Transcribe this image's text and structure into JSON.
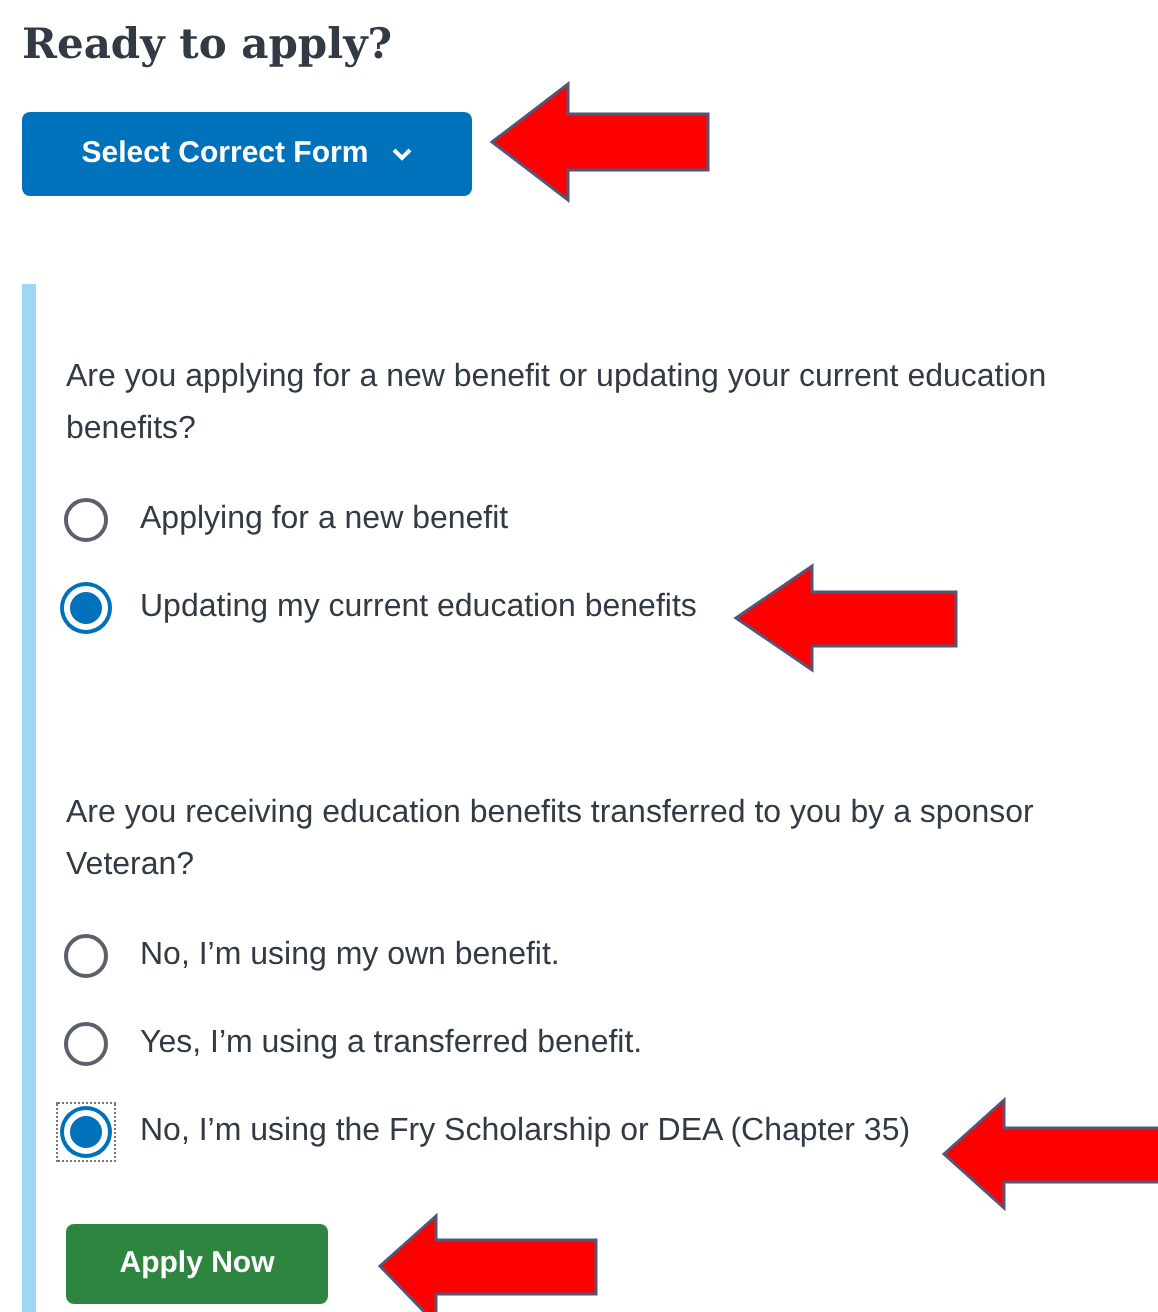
{
  "heading": "Ready to apply?",
  "form_button": {
    "label": "Select Correct Form",
    "expanded": false
  },
  "questions": [
    {
      "prompt": "Are you applying for a new benefit or updating your current education benefits?",
      "options": [
        {
          "label": "Applying for a new benefit",
          "selected": false,
          "focused": false
        },
        {
          "label": "Updating my current education benefits",
          "selected": true,
          "focused": false
        }
      ]
    },
    {
      "prompt": "Are you receiving education benefits transferred to you by a sponsor Veteran?",
      "options": [
        {
          "label": "No, I’m using my own benefit.",
          "selected": false,
          "focused": false
        },
        {
          "label": "Yes, I’m using a transferred benefit.",
          "selected": false,
          "focused": false
        },
        {
          "label": "No, I’m using the Fry Scholarship or DEA (Chapter 35)",
          "selected": true,
          "focused": true
        }
      ]
    }
  ],
  "apply_button": {
    "label": "Apply Now"
  }
}
